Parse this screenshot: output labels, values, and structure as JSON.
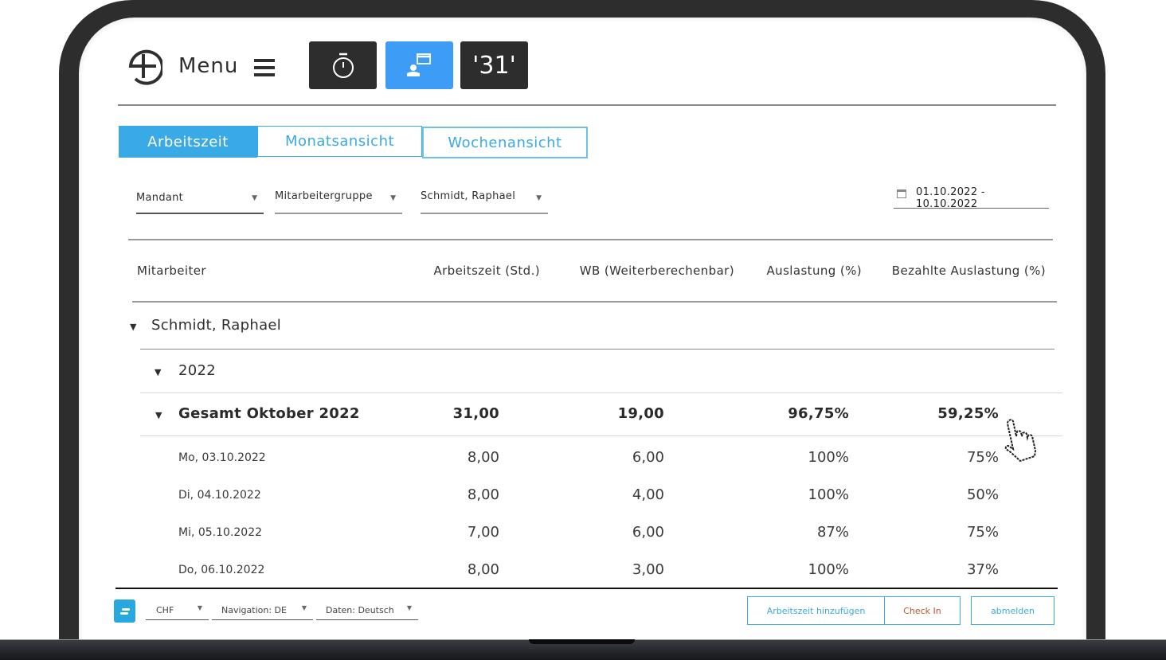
{
  "header": {
    "menu_label": "Menu",
    "toolbar": [
      {
        "name": "timer",
        "icon": "stopwatch-icon"
      },
      {
        "name": "employee-view",
        "icon": "person-window-icon",
        "active": true
      },
      {
        "name": "calendar",
        "label": "'31'"
      }
    ]
  },
  "tabs": [
    {
      "label": "Arbeitszeit",
      "active": true
    },
    {
      "label": "Monatsansicht",
      "active": false
    },
    {
      "label": "Wochenansicht",
      "active": false
    }
  ],
  "filters": {
    "mandant": "Mandant",
    "mitarbeitergruppe": "Mitarbeitergruppe",
    "mitarbeiter": "Schmidt, Raphael",
    "date_range": "01.10.2022 - 10.10.2022"
  },
  "table": {
    "columns": [
      "Mitarbeiter",
      "Arbeitszeit (Std.)",
      "WB (Weiterberechenbar)",
      "Auslastung (%)",
      "Bezahlte Auslastung (%)"
    ],
    "person": "Schmidt, Raphael",
    "year": "2022",
    "total": {
      "label": "Gesamt Oktober 2022",
      "arbeitszeit": "31,00",
      "wb": "19,00",
      "auslastung": "96,75%",
      "bezahlt": "59,25%"
    },
    "days": [
      {
        "date": "Mo, 03.10.2022",
        "arbeitszeit": "8,00",
        "wb": "6,00",
        "auslastung": "100%",
        "bezahlt": "75%"
      },
      {
        "date": "Di, 04.10.2022",
        "arbeitszeit": "8,00",
        "wb": "4,00",
        "auslastung": "100%",
        "bezahlt": "50%"
      },
      {
        "date": "Mi, 05.10.2022",
        "arbeitszeit": "7,00",
        "wb": "6,00",
        "auslastung": "87%",
        "bezahlt": "75%"
      },
      {
        "date": "Do, 06.10.2022",
        "arbeitszeit": "8,00",
        "wb": "3,00",
        "auslastung": "100%",
        "bezahlt": "37%"
      }
    ]
  },
  "footer": {
    "currency": "CHF",
    "navigation": "Navigation: DE",
    "data_language": "Daten: Deutsch",
    "buttons": {
      "add_time": "Arbeitszeit hinzufügen",
      "check_in": "Check In",
      "logout": "abmelden"
    }
  },
  "colors": {
    "accent": "#3aaae6",
    "active_toolbar": "#3d9cf5",
    "dark": "#2d2d2d",
    "check_in": "#c7522a"
  }
}
